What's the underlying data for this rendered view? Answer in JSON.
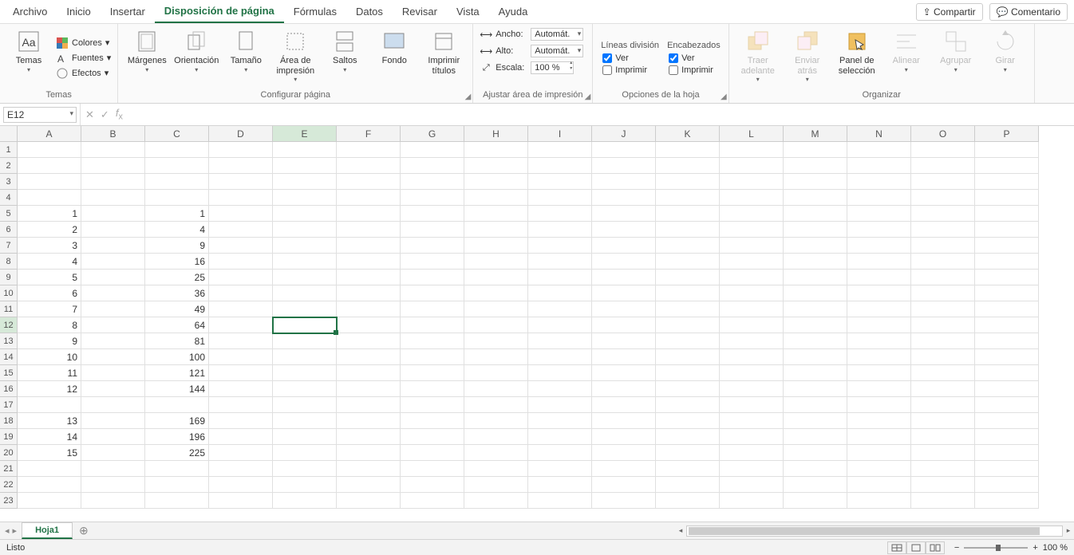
{
  "menu": {
    "items": [
      "Archivo",
      "Inicio",
      "Insertar",
      "Disposición de página",
      "Fórmulas",
      "Datos",
      "Revisar",
      "Vista",
      "Ayuda"
    ],
    "active_index": 3,
    "share": "Compartir",
    "comment": "Comentario"
  },
  "ribbon": {
    "themes": {
      "label": "Temas",
      "temas": "Temas",
      "colores": "Colores",
      "fuentes": "Fuentes",
      "efectos": "Efectos"
    },
    "page_setup": {
      "label": "Configurar página",
      "margenes": "Márgenes",
      "orientacion": "Orientación",
      "tamano": "Tamaño",
      "area": "Área de impresión",
      "saltos": "Saltos",
      "fondo": "Fondo",
      "titulos": "Imprimir títulos"
    },
    "scale_fit": {
      "label": "Ajustar área de impresión",
      "ancho": "Ancho:",
      "alto": "Alto:",
      "escala": "Escala:",
      "auto": "Automát.",
      "scale_val": "100 %"
    },
    "sheet_opts": {
      "label": "Opciones de la hoja",
      "lineas": "Líneas división",
      "encab": "Encabezados",
      "ver": "Ver",
      "imprimir": "Imprimir"
    },
    "arrange": {
      "label": "Organizar",
      "traer": "Traer adelante",
      "enviar": "Enviar atrás",
      "panel": "Panel de selección",
      "alinear": "Alinear",
      "agrupar": "Agrupar",
      "girar": "Girar"
    }
  },
  "namebox": "E12",
  "columns": [
    "A",
    "B",
    "C",
    "D",
    "E",
    "F",
    "G",
    "H",
    "I",
    "J",
    "K",
    "L",
    "M",
    "N",
    "O",
    "P"
  ],
  "selected_col": 4,
  "selected_row": 12,
  "rows_visible": 23,
  "cell_data": {
    "5": {
      "A": "1",
      "C": "1"
    },
    "6": {
      "A": "2",
      "C": "4"
    },
    "7": {
      "A": "3",
      "C": "9"
    },
    "8": {
      "A": "4",
      "C": "16"
    },
    "9": {
      "A": "5",
      "C": "25"
    },
    "10": {
      "A": "6",
      "C": "36"
    },
    "11": {
      "A": "7",
      "C": "49"
    },
    "12": {
      "A": "8",
      "C": "64"
    },
    "13": {
      "A": "9",
      "C": "81"
    },
    "14": {
      "A": "10",
      "C": "100"
    },
    "15": {
      "A": "11",
      "C": "121"
    },
    "16": {
      "A": "12",
      "C": "144"
    },
    "18": {
      "A": "13",
      "C": "169"
    },
    "19": {
      "A": "14",
      "C": "196"
    },
    "20": {
      "A": "15",
      "C": "225"
    }
  },
  "sheet_tab": "Hoja1",
  "status": "Listo",
  "zoom": "100 %"
}
